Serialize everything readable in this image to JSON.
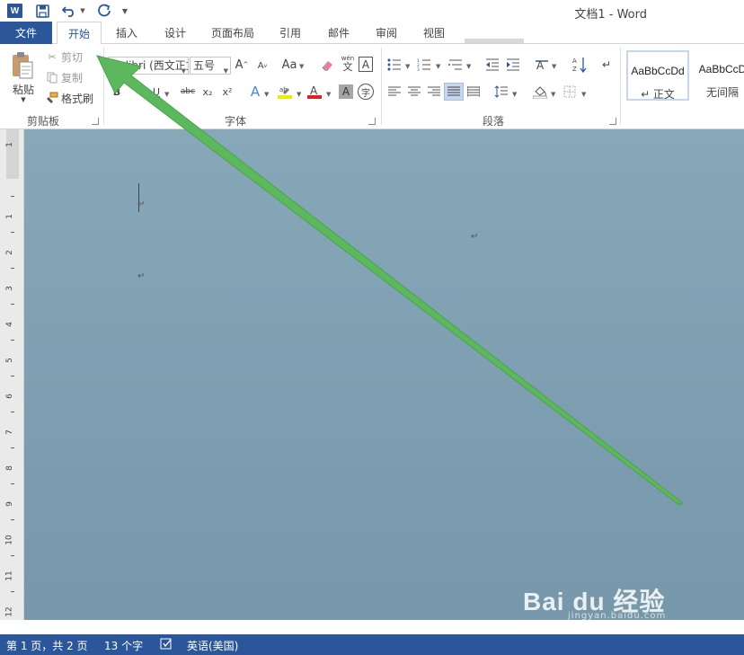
{
  "app": {
    "logo_letter": "W",
    "title": "文档1 - Word"
  },
  "tabs": {
    "file": "文件",
    "items": [
      {
        "label": "开始",
        "active": true
      },
      {
        "label": "插入"
      },
      {
        "label": "设计"
      },
      {
        "label": "页面布局"
      },
      {
        "label": "引用"
      },
      {
        "label": "邮件"
      },
      {
        "label": "审阅"
      },
      {
        "label": "视图"
      }
    ]
  },
  "clipboard": {
    "paste": "粘贴",
    "cut": "剪切",
    "copy": "复制",
    "painter": "格式刷",
    "group_label": "剪贴板"
  },
  "font": {
    "name": "Calibri (西文正文",
    "size": "五号",
    "case_label": "Aa",
    "pinyin_top": "wén",
    "pinyin_bottom": "文",
    "border_char": "A",
    "bold": "B",
    "underline": "U",
    "strike": "abc",
    "subscript": "x₂",
    "superscript": "x²",
    "char_shade": "A",
    "enclose": "字",
    "group_label": "字体"
  },
  "paragraph": {
    "group_label": "段落"
  },
  "styles": {
    "items": [
      {
        "sample": "AaBbCcDd",
        "name": "↵ 正文",
        "selected": true
      },
      {
        "sample": "AaBbCcD",
        "name": "无间隔",
        "selected": false
      }
    ]
  },
  "ruler": {
    "numbers": [
      "1",
      "1",
      "2",
      "3",
      "4",
      "5",
      "6",
      "7",
      "8",
      "9",
      "10",
      "11",
      "12"
    ]
  },
  "document": {
    "para_mark": "↵"
  },
  "watermark": {
    "brand": "Bai du 经验",
    "sub": "jingyan.baidu.com"
  },
  "status": {
    "page": "第 1 页，共 2 页",
    "words": "13 个字",
    "language": "英语(美国)"
  },
  "colors": {
    "brand": "#2b579a",
    "arrow": "#5cb85c",
    "document_bg": "#7f9fb1"
  }
}
